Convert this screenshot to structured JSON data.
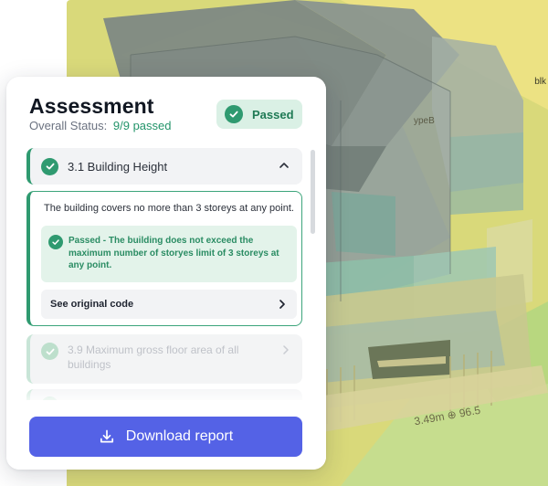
{
  "panel": {
    "title": "Assessment",
    "status_label": "Overall Status:",
    "status_value": "9/9 passed",
    "badge_label": "Passed"
  },
  "items": [
    {
      "label": "3.1 Building Height",
      "expanded": true,
      "status": "passed",
      "description": "The building covers no more than 3 storeys at any point.",
      "result": "Passed - The building does not exceed the maximum number of storyes limit of 3 storeys at any point.",
      "link_label": "See original code"
    },
    {
      "label": "3.9 Maximum gross floor area of all buildings",
      "expanded": false,
      "status": "passed"
    }
  ],
  "footer": {
    "download_label": "Download report"
  },
  "model_labels": {
    "block": "blk",
    "type": "ypeB",
    "dimension": "3.49m ⊕ 96.5"
  },
  "colors": {
    "accent": "#5462e6",
    "success": "#2f9a70",
    "success_bg": "#daf0e5"
  }
}
